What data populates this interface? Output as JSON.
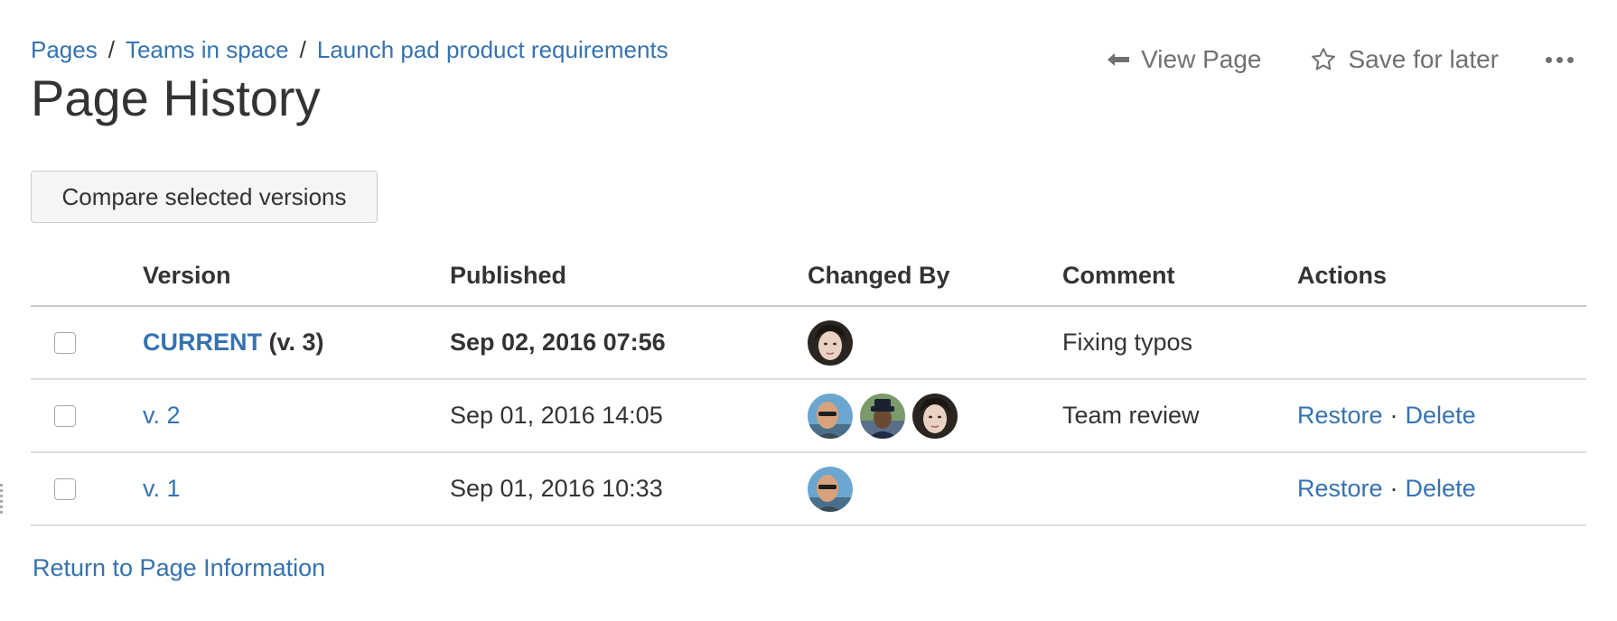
{
  "breadcrumb": {
    "items": [
      "Pages",
      "Teams in space",
      "Launch pad product requirements"
    ],
    "separator": "/"
  },
  "page": {
    "title": "Page History"
  },
  "top_actions": {
    "view_page": "View Page",
    "save_for_later": "Save for later",
    "more_icon": "ellipsis-icon"
  },
  "toolbar": {
    "compare_label": "Compare selected versions"
  },
  "table": {
    "headers": {
      "version": "Version",
      "published": "Published",
      "changed_by": "Changed By",
      "comment": "Comment",
      "actions": "Actions"
    },
    "rows": [
      {
        "version_label": "CURRENT",
        "version_suffix": "(v. 3)",
        "published": "Sep 02, 2016 07:56",
        "avatars": [
          "avatar-woman"
        ],
        "comment": "Fixing typos",
        "restore": "",
        "delete": ""
      },
      {
        "version_label": "v. 2",
        "version_suffix": "",
        "published": "Sep 01, 2016 14:05",
        "avatars": [
          "avatar-man-sunglasses",
          "avatar-man-hat",
          "avatar-woman"
        ],
        "comment": "Team review",
        "restore": "Restore",
        "delete": "Delete"
      },
      {
        "version_label": "v. 1",
        "version_suffix": "",
        "published": "Sep 01, 2016 10:33",
        "avatars": [
          "avatar-man-sunglasses"
        ],
        "comment": "",
        "restore": "Restore",
        "delete": "Delete"
      }
    ],
    "action_separator": "·"
  },
  "footer": {
    "return_link": "Return to Page Information"
  },
  "colors": {
    "link": "#3572b0",
    "text": "#333333",
    "muted": "#707070",
    "border": "#cccccc"
  }
}
